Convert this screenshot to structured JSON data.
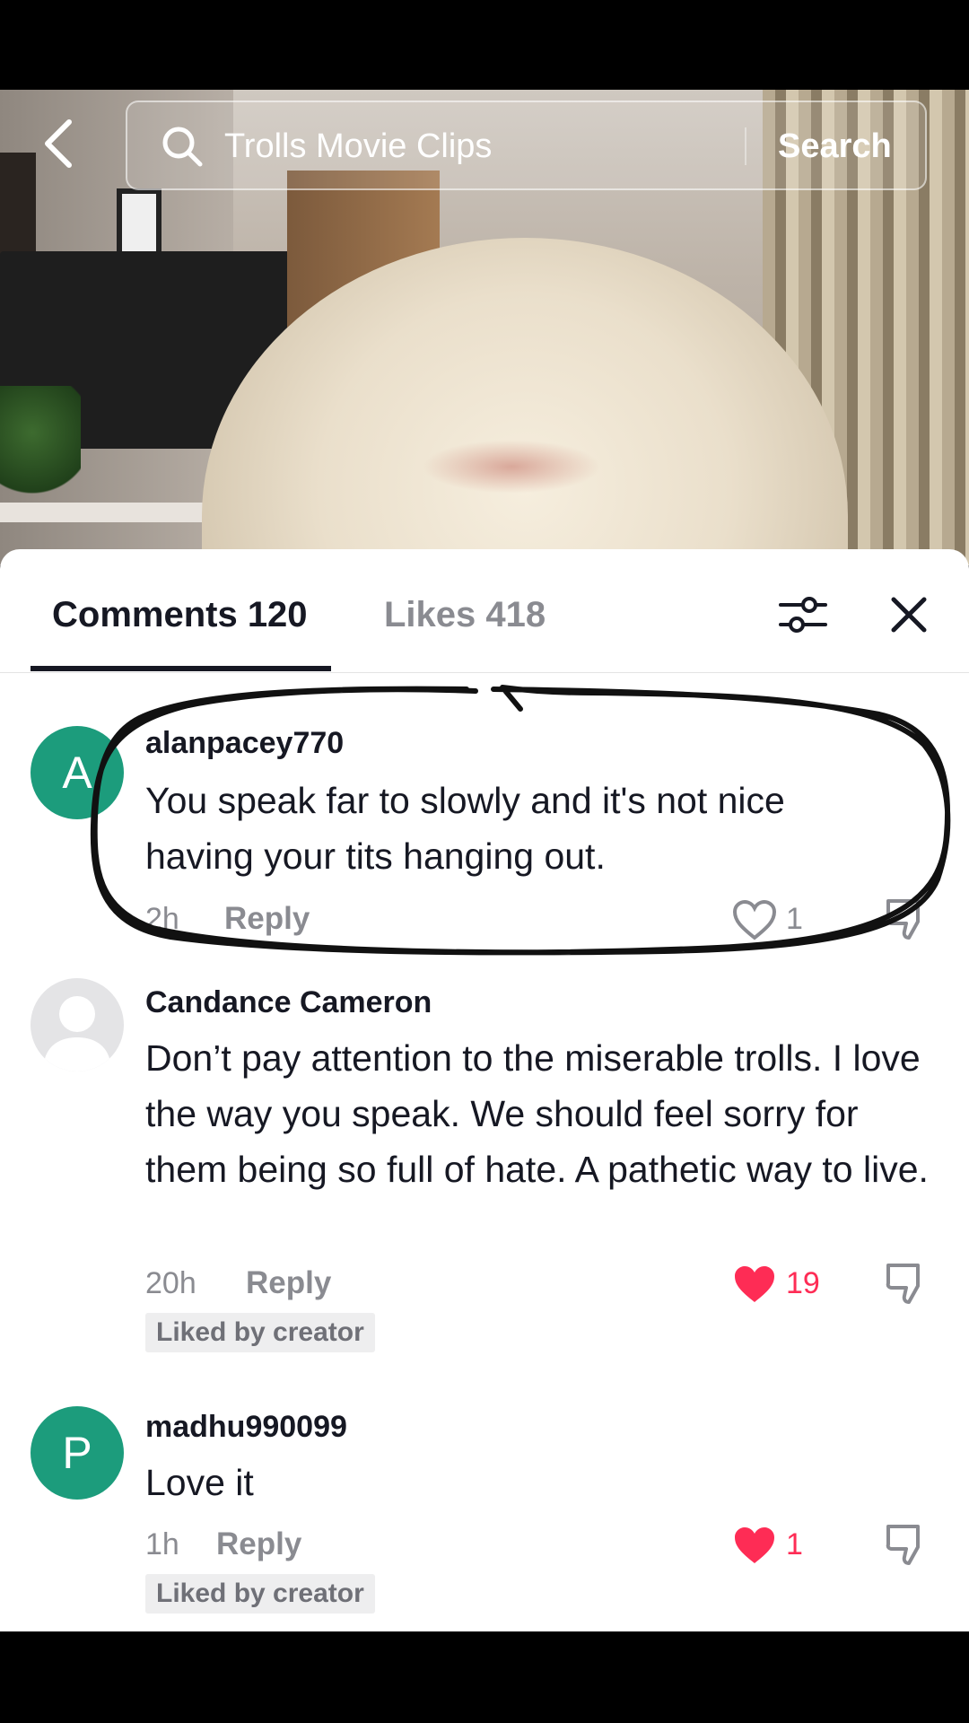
{
  "search": {
    "query": "Trolls Movie Clips",
    "button_label": "Search"
  },
  "tabs": {
    "comments_label": "Comments 120",
    "likes_label": "Likes 418"
  },
  "comments": [
    {
      "avatar_letter": "A",
      "username": "alanpacey770",
      "text": "You speak far to slowly and it's not nice having your tits hanging out.",
      "time": "2h",
      "reply_label": "Reply",
      "likes": "1",
      "liked": false
    },
    {
      "avatar_letter": "",
      "username": "Candance Cameron",
      "text": "Don’t pay attention to the miserable trolls. I love the way you speak. We should feel sorry for them being so full of hate. A pathetic way to live.",
      "time": "20h",
      "reply_label": "Reply",
      "likes": "19",
      "liked": true,
      "badge": "Liked by creator"
    },
    {
      "avatar_letter": "P",
      "username": "madhu990099",
      "text": "Love it",
      "time": "1h",
      "reply_label": "Reply",
      "likes": "1",
      "liked": true,
      "badge": "Liked by creator"
    }
  ],
  "colors": {
    "liked_red": "#fe2c55",
    "avatar_green": "#1c9c7c",
    "muted_text": "#8a8b91",
    "primary_text": "#161823"
  },
  "icons": [
    "back-arrow-icon",
    "search-icon",
    "filter-icon",
    "close-icon",
    "heart-icon",
    "dislike-icon"
  ]
}
